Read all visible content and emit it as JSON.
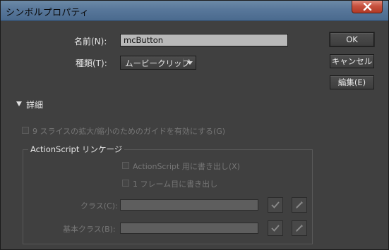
{
  "window": {
    "title": "シンボルプロパティ",
    "close_icon": "close-icon",
    "titlebar_color": "#58779a",
    "close_color": "#c7513e"
  },
  "form": {
    "name_label": "名前(N):",
    "name_value": "mcButton",
    "type_label": "種類(T):",
    "type_value": "ムービークリップ"
  },
  "buttons": {
    "ok": "OK",
    "cancel": "キャンセル",
    "edit": "編集(E)"
  },
  "details": {
    "label": "詳細",
    "nine_slice": "9 スライスの拡大/縮小のためのガイドを有効にする(G)"
  },
  "linkage": {
    "title": "ActionScript リンケージ",
    "export_for_as": "ActionScript 用に書き出し(X)",
    "export_in_frame": "1 フレーム目に書き出し",
    "class_label": "クラス(C):",
    "base_class_label": "基本クラス(B):",
    "class_value": "",
    "base_class_value": "",
    "validate_icon": "checkmark-icon",
    "edit_icon": "pencil-icon"
  }
}
